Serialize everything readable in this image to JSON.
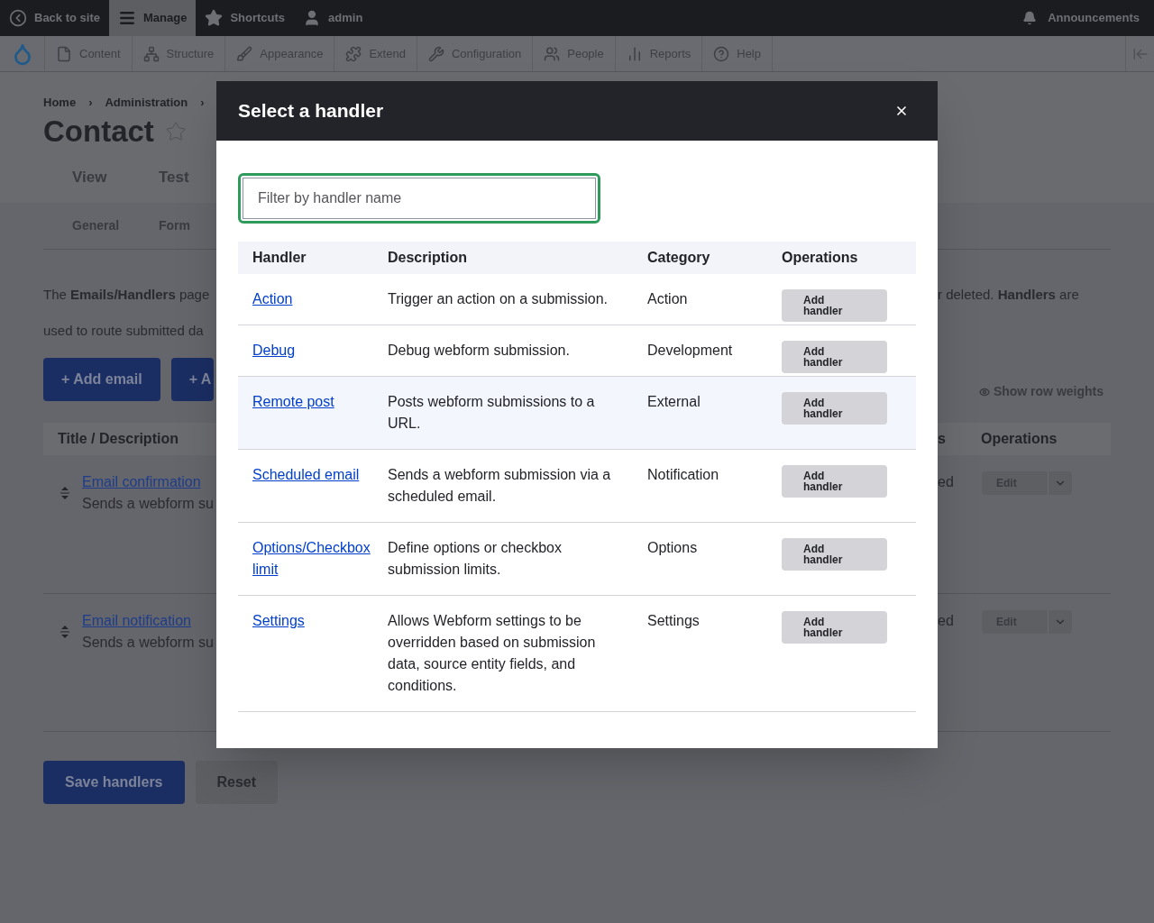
{
  "toolbar": {
    "items": [
      {
        "label": "Back to site",
        "kind": "back",
        "selected": false
      },
      {
        "label": "Manage",
        "kind": "manage",
        "selected": true
      },
      {
        "label": "Shortcuts",
        "kind": "shortcuts",
        "selected": false
      },
      {
        "label": "admin",
        "kind": "user",
        "selected": false
      }
    ],
    "announcements": "Announcements"
  },
  "admin_menu": [
    {
      "label": "Content",
      "kind": "content"
    },
    {
      "label": "Structure",
      "kind": "structure"
    },
    {
      "label": "Appearance",
      "kind": "appearance"
    },
    {
      "label": "Extend",
      "kind": "extend"
    },
    {
      "label": "Configuration",
      "kind": "configuration"
    },
    {
      "label": "People",
      "kind": "people"
    },
    {
      "label": "Reports",
      "kind": "reports"
    },
    {
      "label": "Help",
      "kind": "help"
    }
  ],
  "breadcrumb": [
    {
      "label": "Home",
      "separator": "›"
    },
    {
      "label": "Administration",
      "separator": "›"
    }
  ],
  "page_title": "Contact",
  "primary_tabs": [
    "View",
    "Test"
  ],
  "secondary_tabs": [
    "General",
    "Form"
  ],
  "description": {
    "left": [
      "The **Emails/Handlers** page",
      "used to route submitted da"
    ],
    "right": "r deleted. **Handlers** are"
  },
  "action_buttons": [
    "+ Add email",
    "+ A"
  ],
  "show_row_weights": "Show row weights",
  "handlers_table": {
    "column_left": "Title / Description",
    "column_right_partial": "s",
    "column_operations": "Operations",
    "rows": [
      {
        "title": "Email confirmation",
        "description": "Sends a webform su",
        "status_partial": "ed",
        "operation": "Edit"
      },
      {
        "title": "Email notification",
        "description": "Sends a webform su",
        "status_partial": "ed",
        "operation": "Edit"
      }
    ]
  },
  "form_buttons": [
    {
      "label": "Save handlers",
      "kind": "primary"
    },
    {
      "label": "Reset",
      "kind": "secondary"
    }
  ],
  "modal": {
    "title": "Select a handler",
    "filter": {
      "placeholder": "Filter by handler name"
    },
    "columns": [
      "Handler",
      "Description",
      "Category",
      "Operations"
    ],
    "rows": [
      {
        "handler": "Action",
        "description": "Trigger an action on a submission.",
        "category": "Action",
        "operation": "Add handler",
        "highlighted": false
      },
      {
        "handler": "Debug",
        "description": "Debug webform submission.",
        "category": "Development",
        "operation": "Add handler",
        "highlighted": false
      },
      {
        "handler": "Remote post",
        "description": "Posts webform submissions to a URL.",
        "category": "External",
        "operation": "Add handler",
        "highlighted": true
      },
      {
        "handler": "Scheduled email",
        "description": "Sends a webform submission via a scheduled email.",
        "category": "Notification",
        "operation": "Add handler",
        "highlighted": false
      },
      {
        "handler": "Options/Checkbox limit",
        "description": "Define options or checkbox submission limits.",
        "category": "Options",
        "operation": "Add handler",
        "highlighted": false
      },
      {
        "handler": "Settings",
        "description": "Allows Webform settings to be overridden based on submission data, source entity fields, and conditions.",
        "category": "Settings",
        "operation": "Add handler",
        "highlighted": false
      }
    ]
  }
}
